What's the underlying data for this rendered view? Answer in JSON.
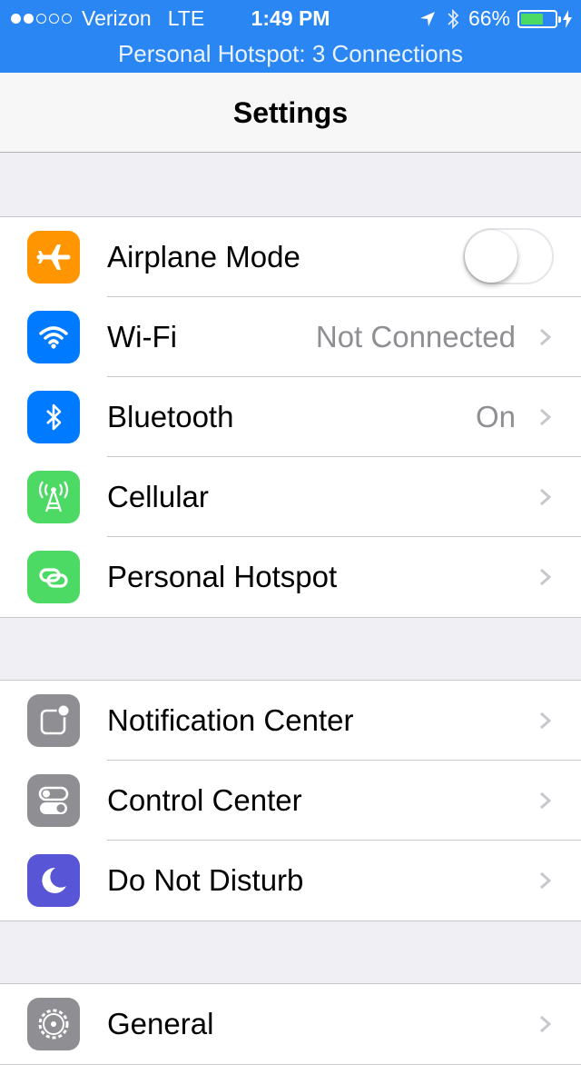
{
  "status_bar": {
    "carrier": "Verizon",
    "network": "LTE",
    "time": "1:49 PM",
    "battery": "66%",
    "battery_level": 0.66,
    "signal_bars_filled": 2,
    "signal_bars_total": 5
  },
  "hotspot_banner": "Personal Hotspot: 3 Connections",
  "nav": {
    "title": "Settings"
  },
  "colors": {
    "status_blue": "#2a86f2",
    "airplane_orange": "#ff9500",
    "blue": "#007aff",
    "green": "#4cd964",
    "gray": "#8e8e93",
    "purple": "#5856d6",
    "battery_green": "#4cd964"
  },
  "groups": [
    {
      "items": [
        {
          "label": "Airplane Mode",
          "icon": "airplane-icon",
          "control": "toggle",
          "toggle_on": false
        },
        {
          "label": "Wi-Fi",
          "icon": "wifi-icon",
          "value": "Not Connected"
        },
        {
          "label": "Bluetooth",
          "icon": "bluetooth-icon",
          "value": "On"
        },
        {
          "label": "Cellular",
          "icon": "cellular-antenna-icon"
        },
        {
          "label": "Personal Hotspot",
          "icon": "hotspot-link-icon"
        }
      ]
    },
    {
      "items": [
        {
          "label": "Notification Center",
          "icon": "notification-center-icon"
        },
        {
          "label": "Control Center",
          "icon": "control-center-icon"
        },
        {
          "label": "Do Not Disturb",
          "icon": "moon-icon"
        }
      ]
    },
    {
      "items": [
        {
          "label": "General",
          "icon": "gear-icon"
        }
      ]
    }
  ]
}
